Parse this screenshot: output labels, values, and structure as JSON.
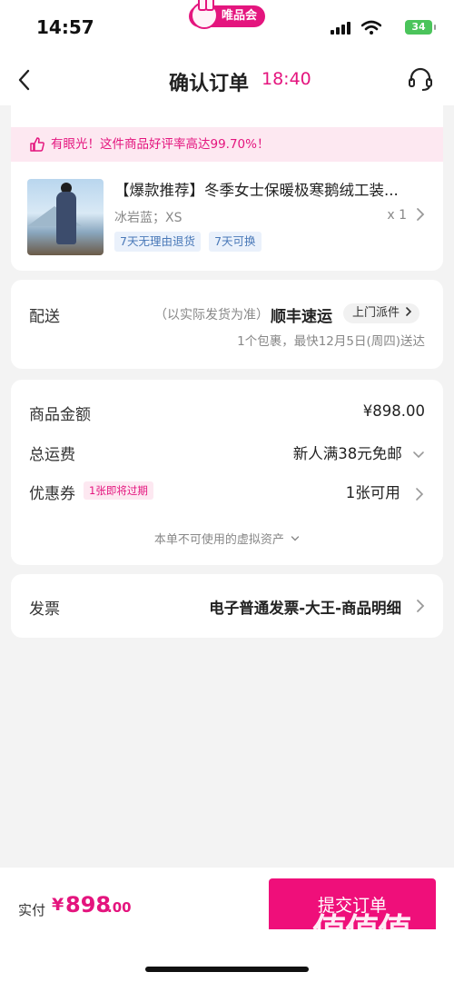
{
  "status_bar": {
    "time": "14:57",
    "app_badge": "唯品会",
    "battery": "34"
  },
  "nav": {
    "title": "确认订单",
    "timer": "18:40"
  },
  "product_card": {
    "praise_text": "有眼光！这件商品好评率高达99.70%！",
    "title": "【爆款推荐】冬季女士保暖极寒鹅绒工装...",
    "spec": "冰岩蓝；XS",
    "qty": "x 1",
    "tags": [
      "7天无理由退货",
      "7天可换"
    ]
  },
  "delivery": {
    "label": "配送",
    "note": "（以实际发货为准）",
    "carrier": "顺丰速运",
    "pickup_label": "上门派件",
    "eta": "1个包裹，最快12月5日(周四)送达"
  },
  "prices": {
    "goods_label": "商品金额",
    "goods_value": "¥898.00",
    "shipping_label": "总运费",
    "shipping_value": "新人满38元免邮",
    "coupon_label": "优惠券",
    "coupon_badge": "1张即将过期",
    "coupon_value": "1张可用",
    "virtual_assets": "本单不可使用的虚拟资产"
  },
  "invoice": {
    "label": "发票",
    "value": "电子普通发票-大王-商品明细"
  },
  "bottom": {
    "pay_label": "实付",
    "pay_symbol": "¥",
    "pay_integer": "898",
    "pay_decimal": ".00",
    "submit_label": "提交订单"
  },
  "watermark": {
    "glyphs": "值值值",
    "url": "zhizhizhi.com"
  },
  "colors": {
    "accent": "#e4157e",
    "button": "#ef0f7a",
    "tag_blue": "#4a79b8",
    "page_bg": "#f3f3f3"
  }
}
